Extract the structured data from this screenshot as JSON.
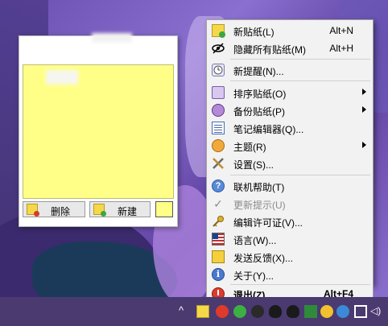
{
  "sticky_note": {
    "content_text": "",
    "delete_label": "删除",
    "new_label": "新建",
    "note_color": "#ffff88"
  },
  "context_menu": {
    "items": [
      {
        "label": "新贴纸(L)",
        "shortcut": "Alt+N",
        "icon": "new-note-icon"
      },
      {
        "label": "隐藏所有贴纸(M)",
        "shortcut": "Alt+H",
        "icon": "hide-eye-icon"
      },
      {
        "label": "新提醒(N)...",
        "icon": "alarm-clock-icon"
      },
      {
        "label": "排序贴纸(O)",
        "submenu": true,
        "icon": "sort-icon"
      },
      {
        "label": "备份贴纸(P)",
        "submenu": true,
        "icon": "backup-icon"
      },
      {
        "label": "笔记编辑器(Q)...",
        "icon": "editor-icon"
      },
      {
        "label": "主题(R)",
        "submenu": true,
        "icon": "palette-icon"
      },
      {
        "label": "设置(S)...",
        "icon": "tools-icon"
      },
      {
        "label": "联机帮助(T)",
        "icon": "help-icon"
      },
      {
        "label": "更新提示(U)",
        "disabled": true,
        "icon": "check-icon"
      },
      {
        "label": "编辑许可证(V)...",
        "icon": "key-icon"
      },
      {
        "label": "语言(W)...",
        "icon": "flag-icon"
      },
      {
        "label": "发送反馈(X)...",
        "icon": "mail-icon"
      },
      {
        "label": "关于(Y)...",
        "icon": "info-icon"
      },
      {
        "label": "退出(Z)",
        "shortcut": "Alt+F4",
        "bold": true,
        "icon": "exit-icon"
      }
    ]
  },
  "taskbar": {
    "show_hidden_icons_glyph": "^",
    "colors": {
      "accent": "#4a3a70"
    }
  }
}
